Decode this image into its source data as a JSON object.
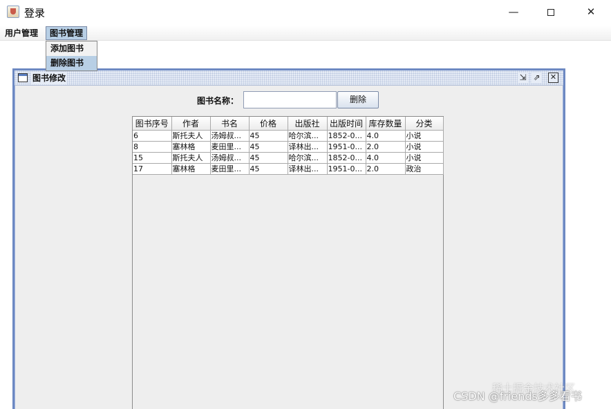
{
  "window": {
    "title": "登录",
    "minimize_glyph": "—",
    "close_glyph": "✕"
  },
  "menubar": {
    "items": [
      {
        "label": "用户管理"
      },
      {
        "label": "图书管理"
      }
    ]
  },
  "dropdown": {
    "items": [
      {
        "label": "添加图书"
      },
      {
        "label": "删除图书"
      }
    ]
  },
  "internal_frame": {
    "title": "图书修改",
    "search_label": "图书名称：",
    "search_value": "",
    "delete_label": "删除",
    "iconify_glyph": "⇲",
    "maximize_glyph": "⇗",
    "close_glyph": "✕"
  },
  "table": {
    "columns": [
      "图书序号",
      "作者",
      "书名",
      "价格",
      "出版社",
      "出版时间",
      "库存数量",
      "分类"
    ],
    "rows": [
      [
        "6",
        "斯托夫人",
        "汤姆叔...",
        "45",
        "哈尔滨...",
        "1852-0...",
        "4.0",
        "小说"
      ],
      [
        "8",
        "塞林格",
        "麦田里...",
        "45",
        "译林出...",
        "1951-0...",
        "2.0",
        "小说"
      ],
      [
        "15",
        "斯托夫人",
        "汤姆叔...",
        "45",
        "哈尔滨...",
        "1852-0...",
        "4.0",
        "小说"
      ],
      [
        "17",
        "塞林格",
        "麦田里...",
        "45",
        "译林出...",
        "1951-0...",
        "2.0",
        "政治"
      ]
    ]
  },
  "watermark": {
    "line1": "稀土掘金技术社区",
    "line2": "CSDN @friends多多看书"
  }
}
